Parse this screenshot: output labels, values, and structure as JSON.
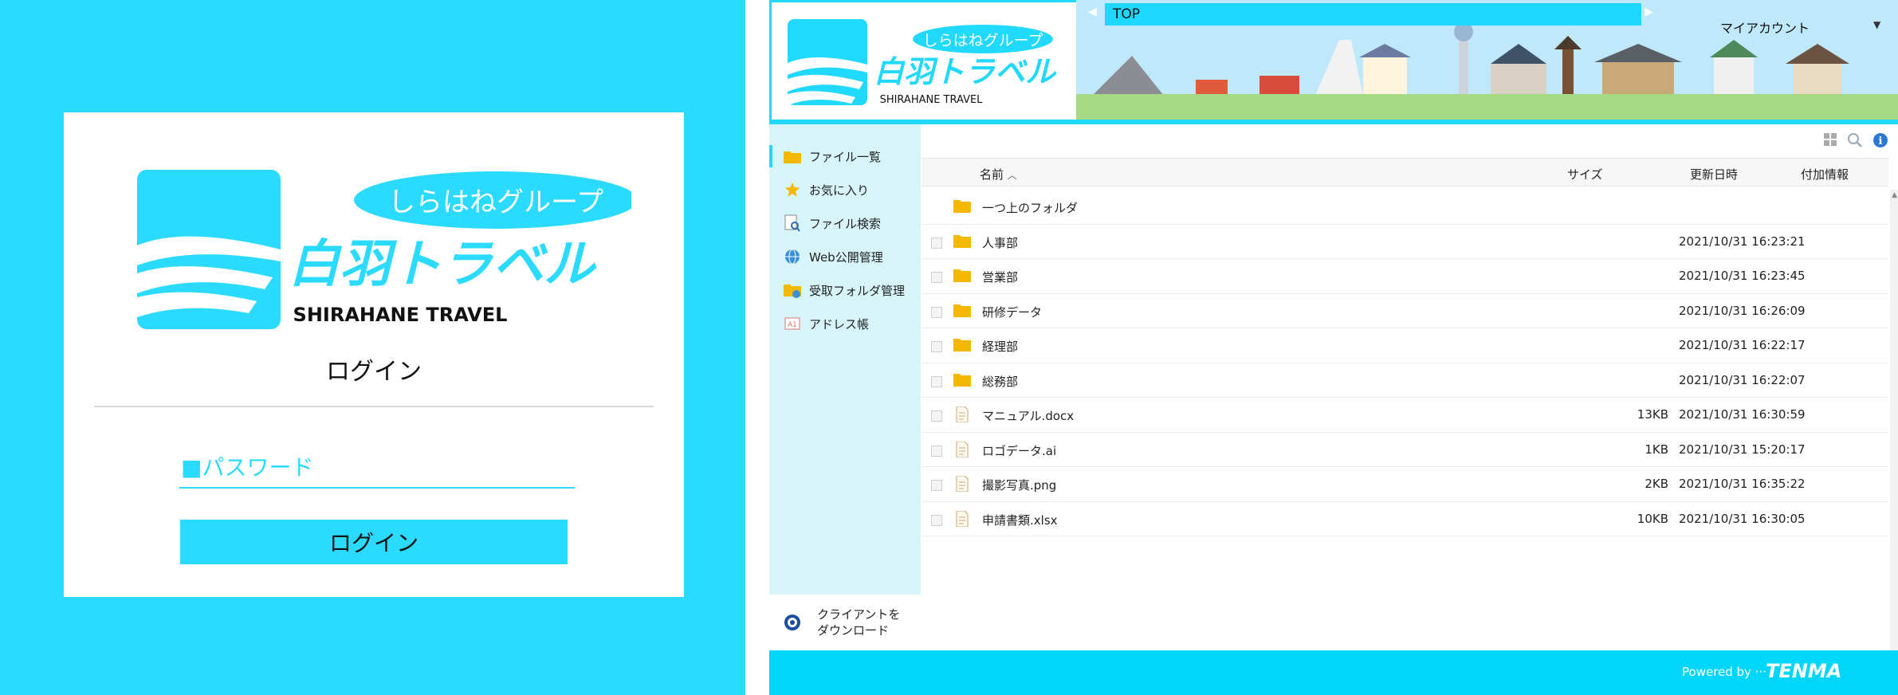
{
  "login": {
    "logo": {
      "group_name": "しらはねグループ",
      "company_name": "白羽トラベル",
      "english_name": "SHIRAHANE TRAVEL"
    },
    "title": "ログイン",
    "password_label": "■パスワード",
    "password_value": "",
    "submit_label": "ログイン"
  },
  "header": {
    "logo": {
      "group_name": "しらはねグループ",
      "company_name": "白羽トラベル",
      "english_name": "SHIRAHANE TRAVEL"
    },
    "breadcrumb": "TOP",
    "account_label": "マイアカウント"
  },
  "sidebar": {
    "items": [
      {
        "label": "ファイル一覧",
        "icon": "folder-icon",
        "active": true
      },
      {
        "label": "お気に入り",
        "icon": "star-icon",
        "active": false
      },
      {
        "label": "ファイル検索",
        "icon": "file-search-icon",
        "active": false
      },
      {
        "label": "Web公開管理",
        "icon": "globe-icon",
        "active": false
      },
      {
        "label": "受取フォルダ管理",
        "icon": "receive-folder-icon",
        "active": false
      },
      {
        "label": "アドレス帳",
        "icon": "address-book-icon",
        "active": false
      }
    ],
    "client_download": "クライアントを\nダウンロード"
  },
  "file_list": {
    "columns": {
      "name": "名前",
      "size": "サイズ",
      "modified": "更新日時",
      "extra": "付加情報"
    },
    "sort": "ascending by name",
    "rows": [
      {
        "name": "一つ上のフォルダ",
        "type": "folder",
        "size": "",
        "modified": "",
        "checkbox": false
      },
      {
        "name": "人事部",
        "type": "folder",
        "size": "",
        "modified": "2021/10/31 16:23:21",
        "checkbox": true
      },
      {
        "name": "営業部",
        "type": "folder",
        "size": "",
        "modified": "2021/10/31 16:23:45",
        "checkbox": true
      },
      {
        "name": "研修データ",
        "type": "folder",
        "size": "",
        "modified": "2021/10/31 16:26:09",
        "checkbox": true
      },
      {
        "name": "経理部",
        "type": "folder",
        "size": "",
        "modified": "2021/10/31 16:22:17",
        "checkbox": true
      },
      {
        "name": "総務部",
        "type": "folder",
        "size": "",
        "modified": "2021/10/31 16:22:07",
        "checkbox": true
      },
      {
        "name": "マニュアル.docx",
        "type": "file",
        "size": "13KB",
        "modified": "2021/10/31 16:30:59",
        "checkbox": true
      },
      {
        "name": "ロゴデータ.ai",
        "type": "file",
        "size": "1KB",
        "modified": "2021/10/31 15:20:17",
        "checkbox": true
      },
      {
        "name": "撮影写真.png",
        "type": "file",
        "size": "2KB",
        "modified": "2021/10/31 16:35:22",
        "checkbox": true
      },
      {
        "name": "申請書類.xlsx",
        "type": "file",
        "size": "10KB",
        "modified": "2021/10/31 16:30:05",
        "checkbox": true
      }
    ]
  },
  "footer": {
    "powered_by": "Powered by ···",
    "brand": "TENMA"
  },
  "colors": {
    "accent": "#21d9fc",
    "login_bg": "#2adbff",
    "sidebar_bg": "#d7f4f9",
    "folder": "#f5b800"
  }
}
